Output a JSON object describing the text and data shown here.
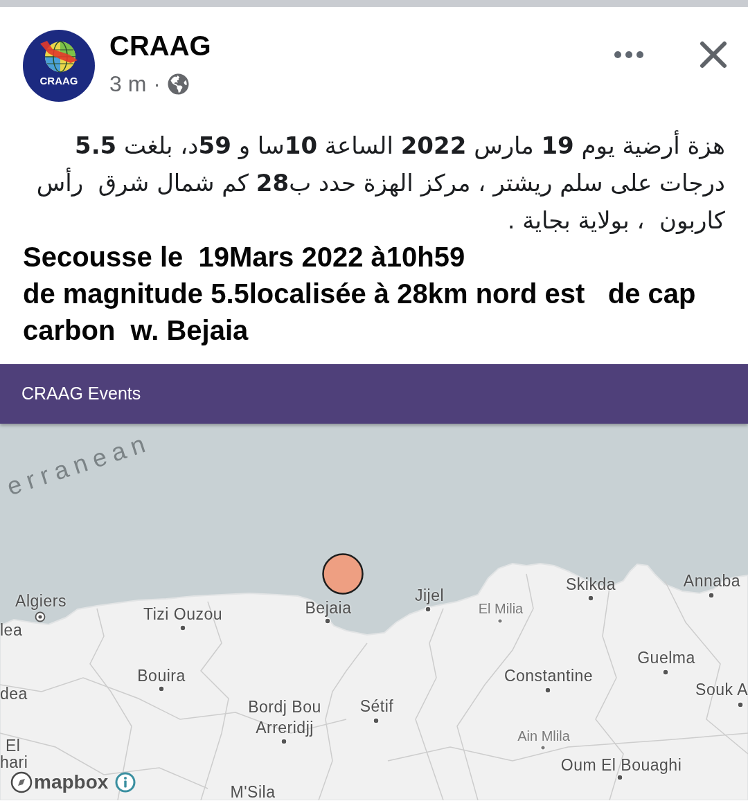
{
  "post": {
    "author": "CRAAG",
    "avatar": {
      "text": "CRAAG"
    },
    "time": "3 m",
    "separator": "·",
    "message_ar": "هزة أرضية يوم **19** مارس **2022** الساعة **10**سا و **59**د، بلغت **5.5** درجات على سلم ريشتر ، مركز الهزة حدد ب**28** كم شمال شرق  رأس كاربون  ، بولاية بجاية .",
    "message_fr": "Secousse le  19Mars 2022 à10h59\nde magnitude 5.5localisée à 28km nord est   de cap carbon  w. Bejaia"
  },
  "link_card": {
    "title": "CRAAG Events",
    "map": {
      "labels": [
        {
          "text": "erranean",
          "kind": "sea"
        },
        {
          "text": "Algiers",
          "kind": "capital"
        },
        {
          "text": "Tizi Ouzou",
          "kind": "city"
        },
        {
          "text": "Bejaia",
          "kind": "city"
        },
        {
          "text": "Jijel",
          "kind": "city"
        },
        {
          "text": "El Milia",
          "kind": "town"
        },
        {
          "text": "Skikda",
          "kind": "city"
        },
        {
          "text": "Annaba",
          "kind": "city"
        },
        {
          "text": "lea",
          "kind": "place"
        },
        {
          "text": "Guelma",
          "kind": "city"
        },
        {
          "text": "Bouira",
          "kind": "city"
        },
        {
          "text": "Constantine",
          "kind": "city"
        },
        {
          "text": "dea",
          "kind": "place"
        },
        {
          "text": "Souk A",
          "kind": "city"
        },
        {
          "text": "Bordj Bou Arreridjj",
          "kind": "city"
        },
        {
          "text": "Sétif",
          "kind": "city"
        },
        {
          "text": "El",
          "kind": "place"
        },
        {
          "text": "Ain Mlila",
          "kind": "town"
        },
        {
          "text": "hari",
          "kind": "place"
        },
        {
          "text": "Oum El Bouaghi",
          "kind": "city"
        },
        {
          "text": "M'Sila",
          "kind": "place"
        }
      ],
      "attribution": "mapbox"
    }
  }
}
